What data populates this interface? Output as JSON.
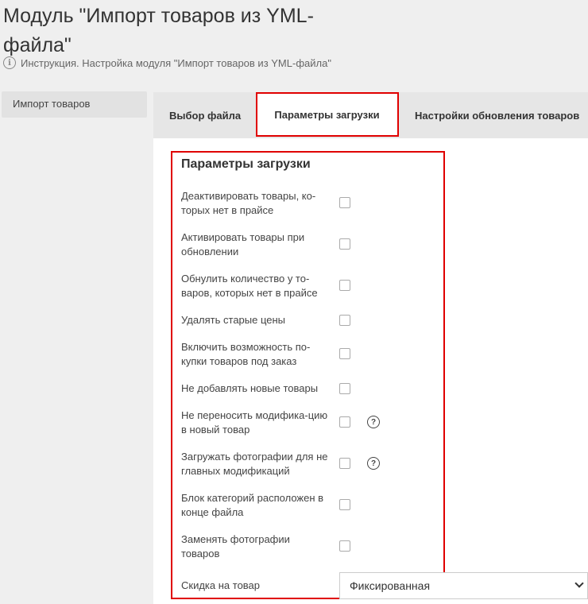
{
  "page": {
    "title": "Модуль \"Импорт товаров из YML-файла\"",
    "instruction": "Инструкция. Настройка модуля \"Импорт товаров из YML-файла\""
  },
  "sidebar": {
    "items": [
      {
        "label": "Импорт товаров"
      }
    ]
  },
  "tabs": [
    {
      "label": "Выбор файла",
      "active": false
    },
    {
      "label": "Параметры загрузки",
      "active": true
    },
    {
      "label": "Настройки обновления товаров",
      "active": false
    }
  ],
  "section": {
    "title": "Параметры загрузки",
    "options": [
      {
        "label": "Деактивировать товары, ко-торых нет в прайсе",
        "checked": false
      },
      {
        "label": "Активировать товары при обновлении",
        "checked": false
      },
      {
        "label": "Обнулить количество у то-варов, которых нет в прайсе",
        "checked": false
      },
      {
        "label": "Удалять старые цены",
        "checked": false
      },
      {
        "label": "Включить возможность по-купки товаров под заказ",
        "checked": false
      },
      {
        "label": "Не добавлять новые товары",
        "checked": false
      },
      {
        "label": "Не переносить модифика-цию в новый товар",
        "checked": false,
        "help": "?"
      },
      {
        "label": "Загружать фотографии для не главных модификаций",
        "checked": false,
        "help": "?"
      },
      {
        "label": "Блок категорий расположен в конце файла",
        "checked": false
      },
      {
        "label": "Заменять фотографии товаров",
        "checked": false
      }
    ],
    "discount": {
      "label": "Скидка на товар",
      "selected": "Фиксированная"
    }
  },
  "colors": {
    "highlight": "#e00000",
    "background": "#efefef",
    "tab_bar": "#e6e6e6"
  }
}
